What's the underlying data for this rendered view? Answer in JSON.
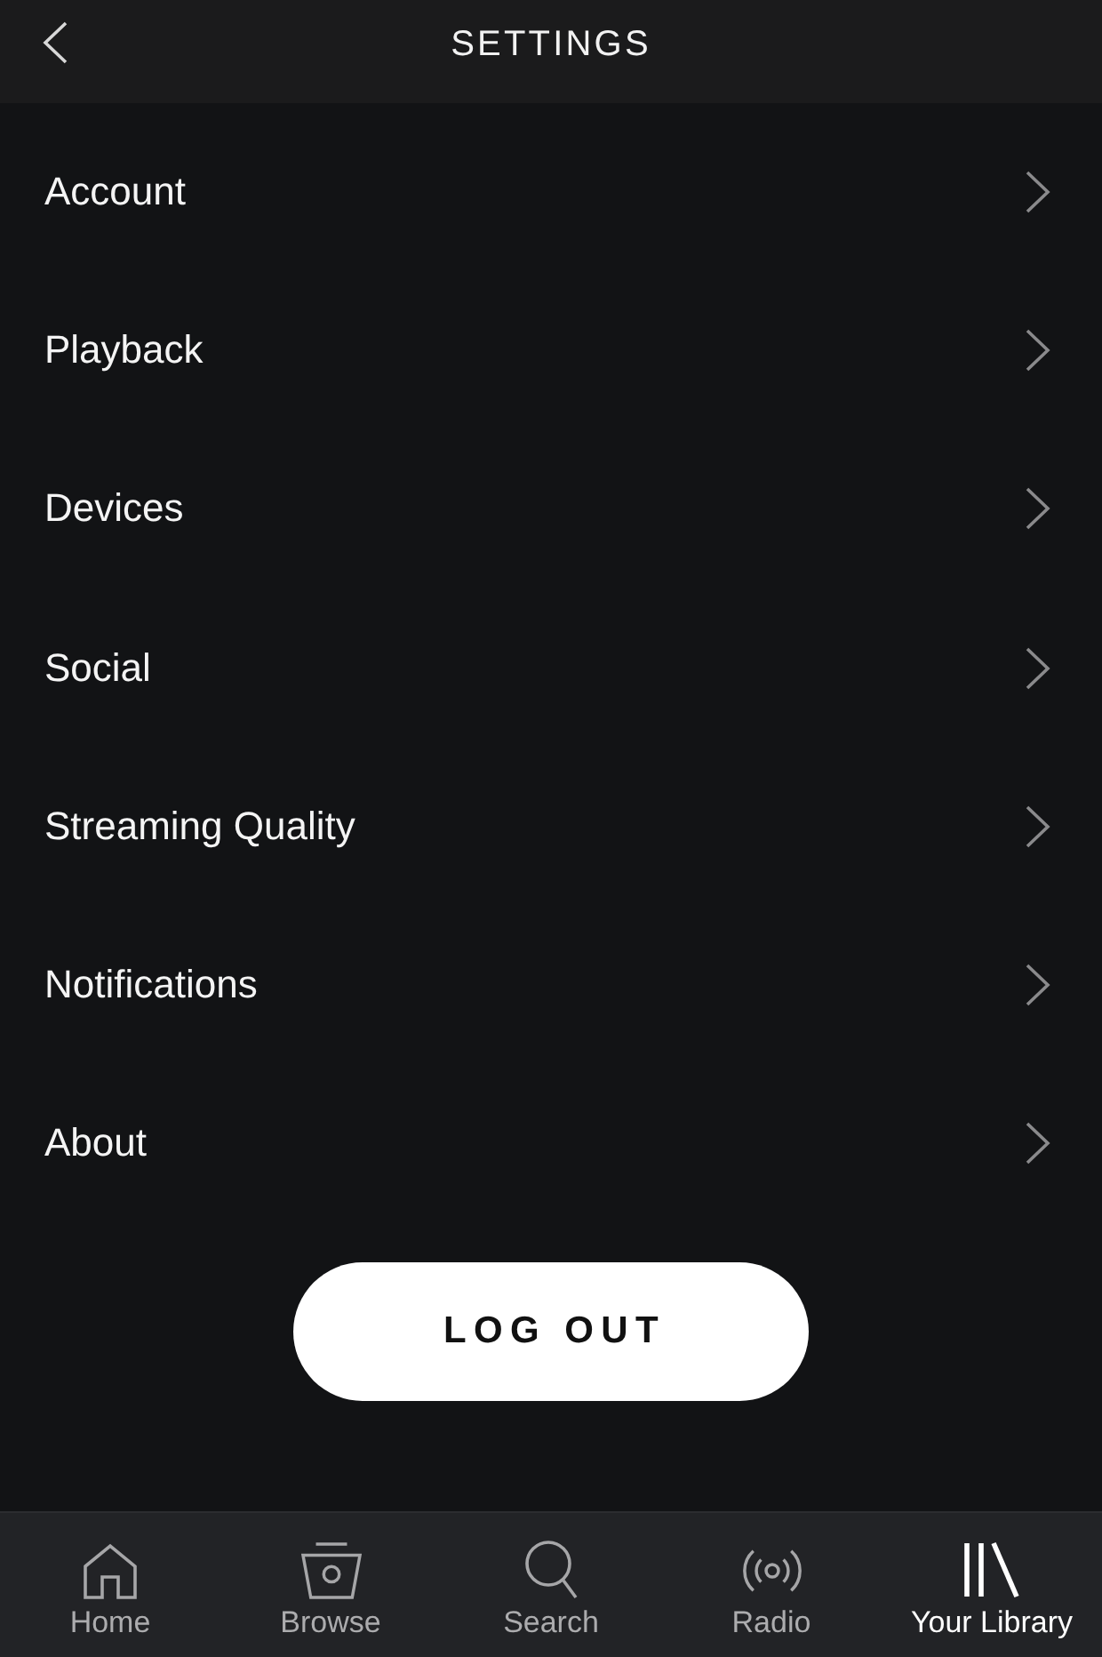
{
  "header": {
    "title": "SETTINGS"
  },
  "settings_items": [
    {
      "label": "Account"
    },
    {
      "label": "Playback"
    },
    {
      "label": "Devices"
    },
    {
      "label": "Social"
    },
    {
      "label": "Streaming Quality"
    },
    {
      "label": "Notifications"
    },
    {
      "label": "About"
    }
  ],
  "logout_button": {
    "label": "LOG OUT"
  },
  "tab_bar": {
    "tabs": [
      {
        "kind": "home",
        "label": "Home",
        "selected": false
      },
      {
        "kind": "browse",
        "label": "Browse",
        "selected": false
      },
      {
        "kind": "search",
        "label": "Search",
        "selected": false
      },
      {
        "kind": "radio",
        "label": "Radio",
        "selected": false
      },
      {
        "kind": "library",
        "label": "Your Library",
        "selected": true
      }
    ]
  }
}
